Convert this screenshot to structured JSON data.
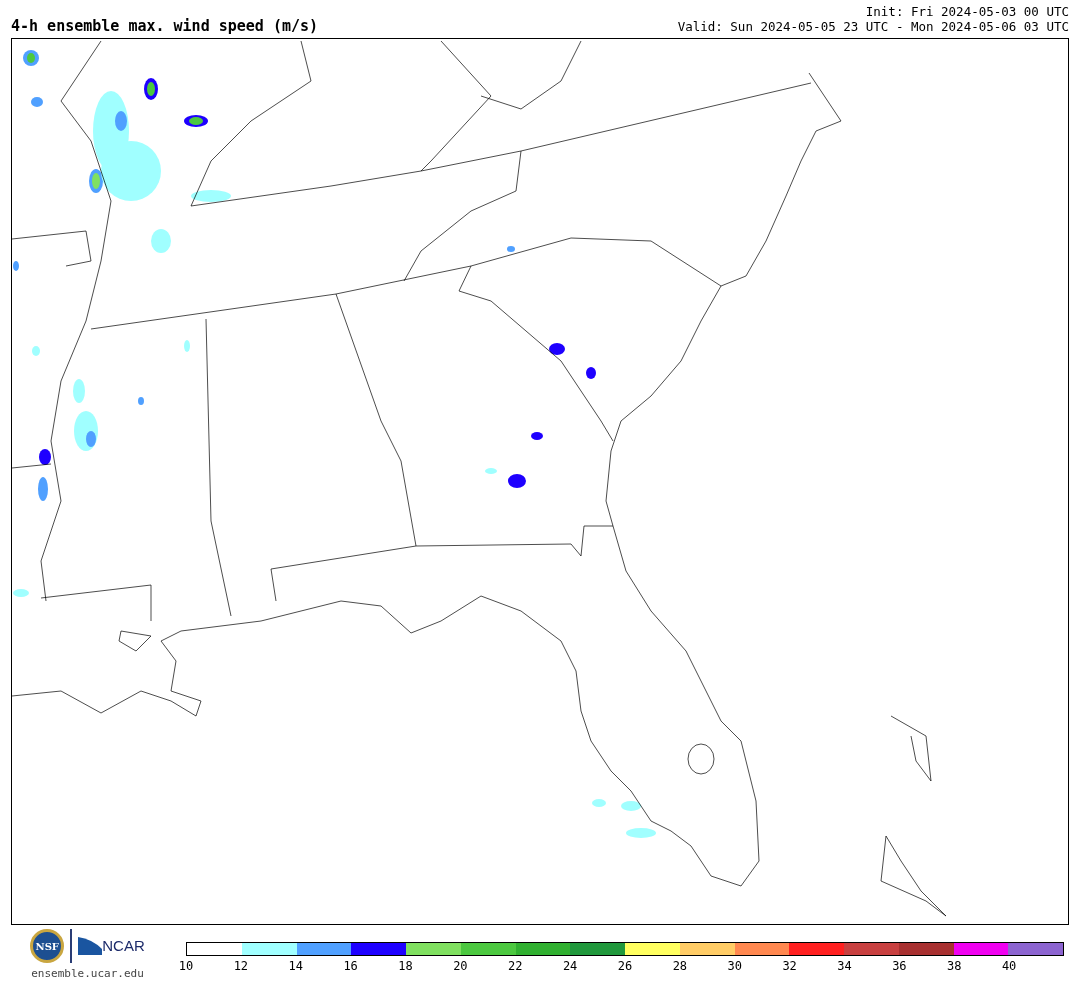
{
  "title": "4-h ensemble max. wind speed (m/s)",
  "init": "Init: Fri 2024-05-03 00 UTC",
  "valid": "Valid: Sun 2024-05-05 23 UTC - Mon 2024-05-06 03 UTC",
  "logos": {
    "nsf": "NSF",
    "ncar": "NCAR",
    "url": "ensemble.ucar.edu"
  },
  "colorbar": {
    "segments": [
      {
        "color": "#ffffff"
      },
      {
        "color": "#a0ffff"
      },
      {
        "color": "#50a0ff"
      },
      {
        "color": "#1e00ff"
      },
      {
        "color": "#80e060"
      },
      {
        "color": "#4cc840"
      },
      {
        "color": "#30b030"
      },
      {
        "color": "#20983c"
      },
      {
        "color": "#ffff60"
      },
      {
        "color": "#ffcc66"
      },
      {
        "color": "#ff8850"
      },
      {
        "color": "#ff2020"
      },
      {
        "color": "#c84040"
      },
      {
        "color": "#a83030"
      },
      {
        "color": "#f000f0"
      },
      {
        "color": "#8c64d0"
      }
    ],
    "ticks": [
      "10",
      "12",
      "14",
      "16",
      "18",
      "20",
      "22",
      "24",
      "26",
      "28",
      "30",
      "32",
      "34",
      "36",
      "38",
      "40"
    ]
  }
}
